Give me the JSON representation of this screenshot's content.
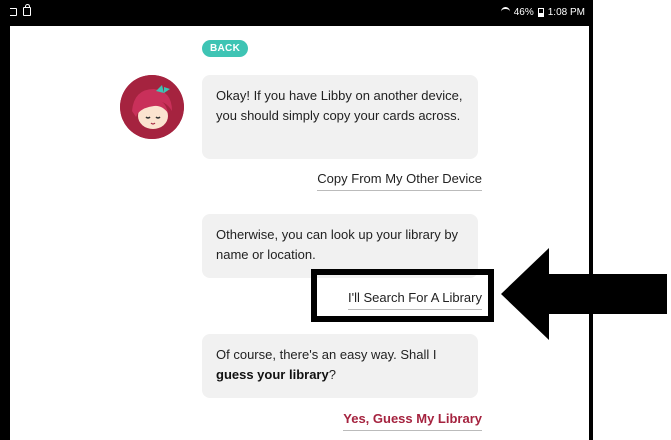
{
  "status_bar": {
    "battery": "46%",
    "time": "1:08 PM"
  },
  "chat": {
    "back_label": "BACK",
    "message1": "Okay! If you have Libby on another device, you should simply copy your cards across.",
    "reply1": "Copy From My Other Device",
    "message2": "Otherwise, you can look up your library by name or location.",
    "reply2": "I'll Search For A Library",
    "message3_prefix": "Of course, there's an easy way. Shall I ",
    "message3_bold": "guess your library",
    "message3_suffix": "?",
    "reply3": "Yes, Guess My Library"
  },
  "colors": {
    "accent": "#a5233f",
    "back_button": "#3ec4b4",
    "bubble": "#f1f1f1"
  }
}
